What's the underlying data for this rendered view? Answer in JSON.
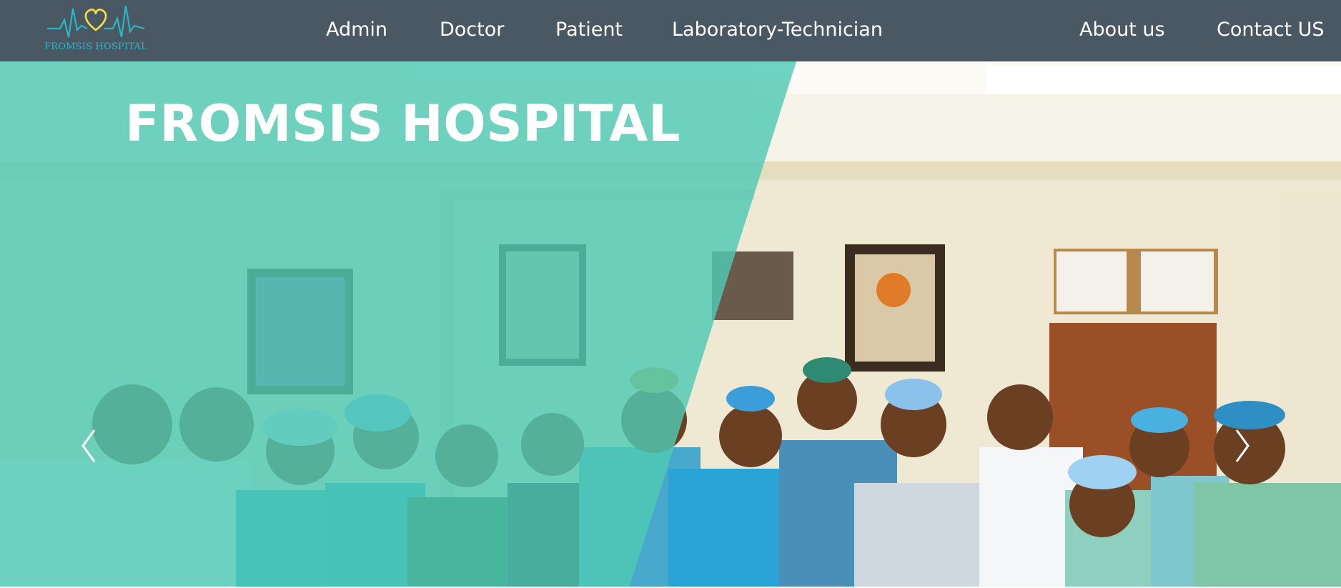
{
  "logo": {
    "text": "FROMSIS HOSPITAL",
    "icon": "heartbeat-heart-icon"
  },
  "nav": {
    "admin": "Admin",
    "doctor": "Doctor",
    "patient": "Patient",
    "lab_technician": "Laboratory-Technician",
    "about": "About us",
    "contact": "Contact US"
  },
  "hero": {
    "title": "FROMSIS HOSPITAL",
    "prev_icon": "chevron-left-icon",
    "next_icon": "chevron-right-icon"
  },
  "colors": {
    "navbar": "#4a5863",
    "overlay": "#4fc9b3",
    "logo_accent": "#2ab7c4",
    "heart": "#f3e04a"
  }
}
